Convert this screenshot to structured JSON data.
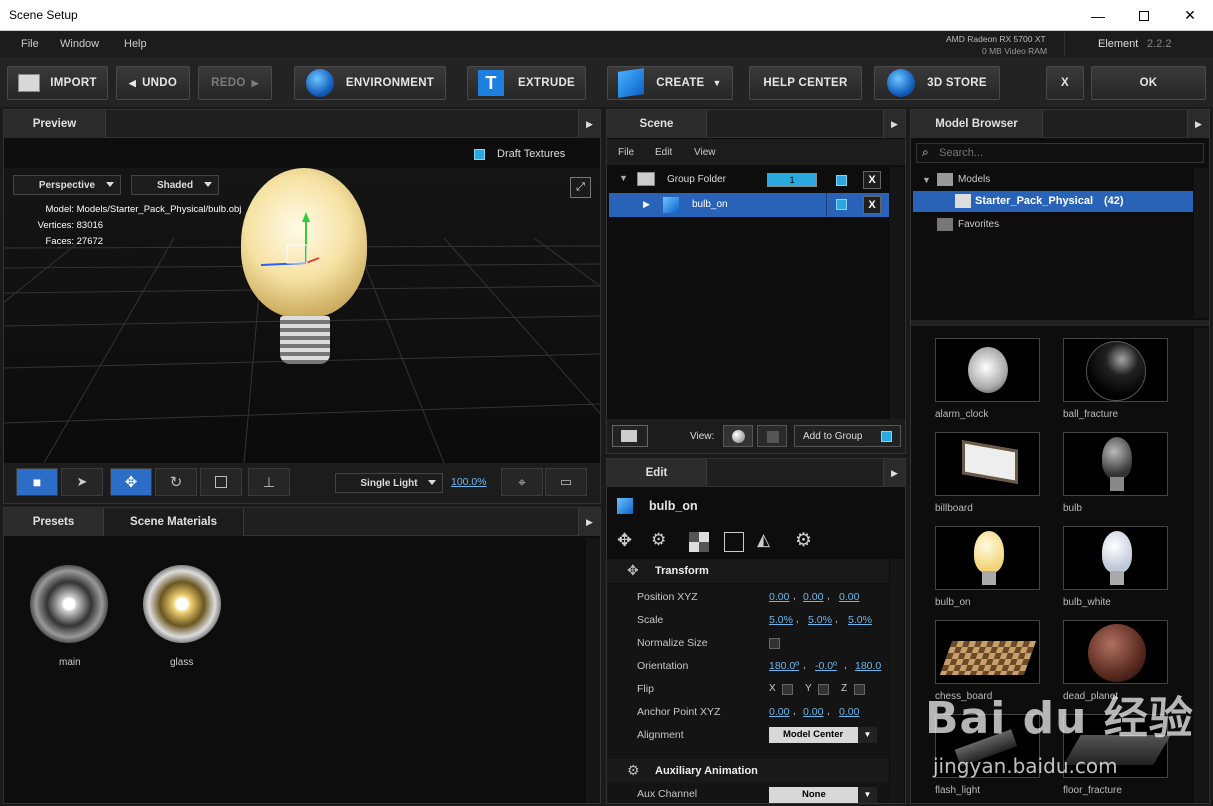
{
  "window": {
    "title": "Scene Setup"
  },
  "menubar": {
    "items": [
      "File",
      "Window",
      "Help"
    ],
    "gpu": "AMD Radeon RX 5700 XT",
    "vram": "0 MB Video RAM",
    "product": "Element",
    "version": "2.2.2"
  },
  "toolbar": {
    "import": "IMPORT",
    "undo": "UNDO",
    "redo": "REDO",
    "environment": "ENVIRONMENT",
    "extrude": "EXTRUDE",
    "create": "CREATE",
    "help_center": "HELP CENTER",
    "store": "3D STORE",
    "cancel": "X",
    "ok": "OK"
  },
  "preview": {
    "tab": "Preview",
    "draft_textures": "Draft Textures",
    "projection": "Perspective",
    "shading": "Shaded",
    "model_label": "Model:",
    "model_value": "Models/Starter_Pack_Physical/bulb.obj",
    "vertices_label": "Vertices:",
    "vertices_value": "83016",
    "faces_label": "Faces:",
    "faces_value": "27672",
    "light_mode": "Single Light",
    "zoom": "100.0%"
  },
  "presets": {
    "tabs": [
      "Presets",
      "Scene Materials"
    ],
    "materials": [
      "main",
      "glass"
    ]
  },
  "scene": {
    "tab": "Scene",
    "menu": [
      "File",
      "Edit",
      "View"
    ],
    "group_folder": "Group Folder",
    "group_number": "1",
    "item": "bulb_on",
    "view_label": "View:",
    "add_to_group": "Add to Group"
  },
  "edit": {
    "tab": "Edit",
    "object_name": "bulb_on",
    "transform_title": "Transform",
    "position_label": "Position XYZ",
    "position": [
      "0.00",
      "0.00",
      "0.00"
    ],
    "scale_label": "Scale",
    "scale": [
      "5.0%",
      "5.0%",
      "5.0%"
    ],
    "normalize_label": "Normalize Size",
    "orientation_label": "Orientation",
    "orientation": [
      "180.0º",
      "-0.0º",
      "180.0"
    ],
    "flip_label": "Flip",
    "flip_axes": [
      "X",
      "Y",
      "Z"
    ],
    "anchor_label": "Anchor Point XYZ",
    "anchor": [
      "0.00",
      "0.00",
      "0.00"
    ],
    "alignment_label": "Alignment",
    "alignment_value": "Model Center",
    "aux_title": "Auxiliary Animation",
    "aux_channel_label": "Aux Channel",
    "aux_channel_value": "None"
  },
  "browser": {
    "tab": "Model Browser",
    "search_placeholder": "Search...",
    "tree": {
      "models": "Models",
      "pack": "Starter_Pack_Physical",
      "pack_count": "(42)",
      "favorites": "Favorites"
    },
    "thumbnails": [
      "alarm_clock",
      "ball_fracture",
      "billboard",
      "bulb",
      "bulb_on",
      "bulb_white",
      "chess_board",
      "dead_planet",
      "flash_light",
      "floor_fracture"
    ]
  },
  "watermark": {
    "text": "Bai du 经验",
    "url": "jingyan.baidu.com"
  }
}
